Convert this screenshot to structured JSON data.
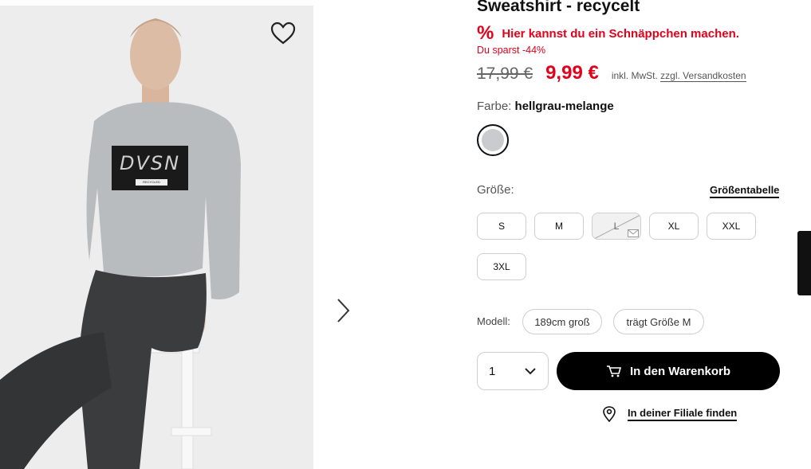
{
  "product": {
    "title": "Sweatshirt - recycelt",
    "deal_icon": "%",
    "deal_text": "Hier kannst du ein Schnäppchen machen.",
    "savings": "Du sparst -44%",
    "old_price": "17,99 €",
    "new_price": "9,99 €",
    "vat_text": "inkl. MwSt.",
    "shipping_link": "zzgl. Versandkosten"
  },
  "color": {
    "label": "Farbe:",
    "value": "hellgrau-melange",
    "swatch_color": "#c9cccf"
  },
  "size": {
    "label": "Größe:",
    "table_link": "Größentabelle",
    "options": [
      {
        "label": "S",
        "available": true
      },
      {
        "label": "M",
        "available": true
      },
      {
        "label": "L",
        "available": false
      },
      {
        "label": "XL",
        "available": true
      },
      {
        "label": "XXL",
        "available": true
      },
      {
        "label": "3XL",
        "available": true
      }
    ]
  },
  "model": {
    "label": "Modell:",
    "height": "189cm groß",
    "wears": "trägt Größe M"
  },
  "purchase": {
    "quantity": "1",
    "cart_button": "In den Warenkorb",
    "store_link": "In deiner Filiale finden"
  },
  "image": {
    "print_text": "DVSN",
    "print_subtext": "RECYCLED"
  },
  "colors": {
    "accent_red": "#e3001b",
    "primary_black": "#000000"
  },
  "icons": [
    "heart-icon",
    "chevron-right-icon",
    "percent-icon",
    "mail-icon",
    "chevron-down-icon",
    "cart-icon",
    "location-pin-icon"
  ]
}
